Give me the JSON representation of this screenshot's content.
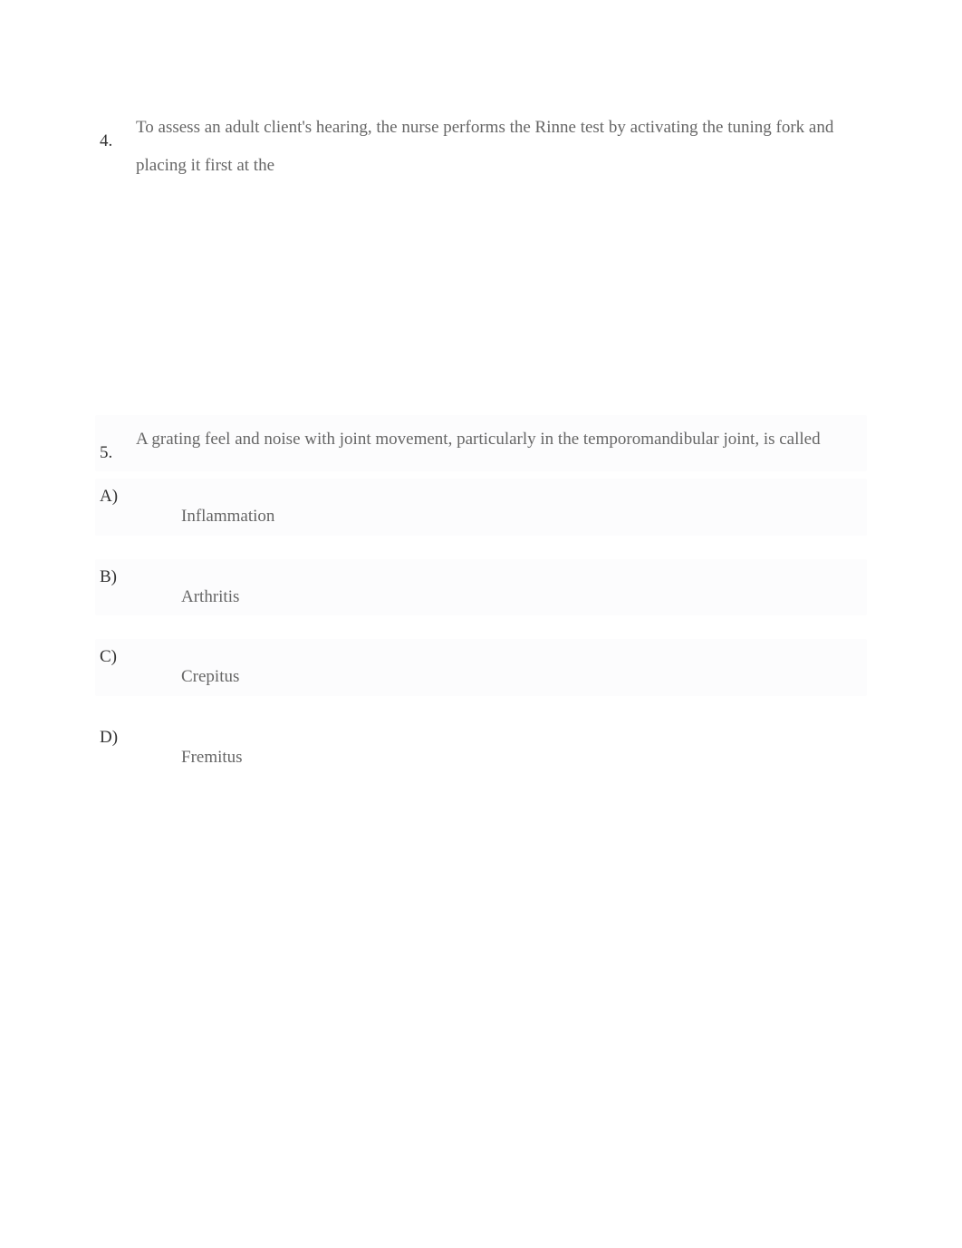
{
  "questions": [
    {
      "number": "4.",
      "text": "To assess an adult client's hearing, the nurse performs the Rinne test by activating the tuning fork and placing it first at the"
    },
    {
      "number": "5.",
      "text": "A grating feel and noise with joint movement, particularly in the temporomandibular joint, is called",
      "options": [
        {
          "letter": "A)",
          "text": "Inflammation"
        },
        {
          "letter": "B)",
          "text": "Arthritis"
        },
        {
          "letter": "C)",
          "text": "Crepitus"
        },
        {
          "letter": "D)",
          "text": "Fremitus"
        }
      ]
    }
  ]
}
